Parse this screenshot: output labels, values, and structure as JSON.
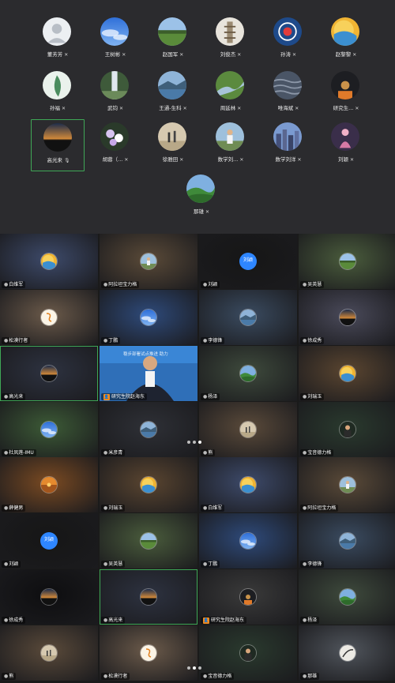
{
  "top_panel": {
    "participants": [
      {
        "name": "董芳芳",
        "avatar": "default-avatar"
      },
      {
        "name": "王树彬",
        "avatar": "blue-sky"
      },
      {
        "name": "赵国军",
        "avatar": "green-field"
      },
      {
        "name": "刘俊杰",
        "avatar": "pagoda"
      },
      {
        "name": "孙涛",
        "avatar": "blue-logo"
      },
      {
        "name": "赵黎黎",
        "avatar": "yellow-orb"
      },
      {
        "name": "孙福",
        "avatar": "green-plant"
      },
      {
        "name": "武钧",
        "avatar": "waterfall"
      },
      {
        "name": "王通-生科",
        "avatar": "lake"
      },
      {
        "name": "周延林",
        "avatar": "river-valley"
      },
      {
        "name": "唯海斌",
        "avatar": "water"
      },
      {
        "name": "研究生...",
        "avatar": "dark-portrait"
      },
      {
        "name": "高光来",
        "avatar": "sunset"
      },
      {
        "name": "胡蓉（...",
        "avatar": "flowers"
      },
      {
        "name": "徐雅田",
        "avatar": "beach-people"
      },
      {
        "name": "数学刘...",
        "avatar": "person-outdoor"
      },
      {
        "name": "数学刘洋",
        "avatar": "city"
      },
      {
        "name": "刘颖",
        "avatar": "pink-figure"
      },
      {
        "name": "那雄",
        "avatar": "green-hills"
      }
    ]
  },
  "grid1": {
    "tiles": [
      {
        "name": "白维军",
        "avatar": "yellow-orb",
        "bg": "#3d4a6a"
      },
      {
        "name": "阿拉坦宝力格",
        "avatar": "person-outdoor",
        "bg": "#5a4a38"
      },
      {
        "name": "刘颖",
        "avatar": "text",
        "avatar_text": "刘颖",
        "bg": "#161616"
      },
      {
        "name": "吴英慧",
        "avatar": "green-field",
        "bg": "#4a5c3c"
      },
      {
        "name": "松漠行者",
        "avatar": "logo-orange",
        "bg": "#6b5a4a"
      },
      {
        "name": "丁鹏",
        "avatar": "blue-sky",
        "bg": "#2e4a7a"
      },
      {
        "name": "李德锋",
        "avatar": "lake",
        "bg": "#3a4b60"
      },
      {
        "name": "徐成秀",
        "avatar": "sunset",
        "bg": "#4a4a5a"
      },
      {
        "name": "高光来",
        "avatar": "sunset",
        "bg": "#2d3240"
      },
      {
        "name": "研究生院赵海东",
        "avatar": "live-video",
        "bg": "#ffffff"
      },
      {
        "name": "杨泽",
        "avatar": "green-hills",
        "bg": "#3e4a3c"
      },
      {
        "name": "刘瑞玉",
        "avatar": "yellow-orb",
        "bg": "#5a4530"
      },
      {
        "name": "杜凤莲-IMU",
        "avatar": "blue-sky",
        "bg": "#3c5a36"
      },
      {
        "name": "米彦青",
        "avatar": "lake",
        "bg": "#2e3036"
      },
      {
        "name": "熊",
        "avatar": "beach-people",
        "bg": "#5a4a3a"
      },
      {
        "name": "宝音德力格",
        "avatar": "person-dark",
        "bg": "#2a3a2e"
      }
    ],
    "page_dots": 3,
    "active_dot": 2
  },
  "grid2": {
    "tiles": [
      {
        "name": "薛健男",
        "avatar": "sunset-orange",
        "bg": "#7a4a22"
      },
      {
        "name": "刘瑞玉",
        "avatar": "yellow-orb",
        "bg": "#5a4530"
      },
      {
        "name": "白维军",
        "avatar": "yellow-orb",
        "bg": "#3d4a6a"
      },
      {
        "name": "阿拉坦宝力格",
        "avatar": "person-outdoor",
        "bg": "#5a4a38"
      },
      {
        "name": "刘颖",
        "avatar": "text",
        "avatar_text": "刘颖",
        "bg": "#161616"
      },
      {
        "name": "吴英慧",
        "avatar": "green-field",
        "bg": "#4a5c3c"
      },
      {
        "name": "丁鹏",
        "avatar": "blue-sky",
        "bg": "#2e4a7a"
      },
      {
        "name": "李德锋",
        "avatar": "lake",
        "bg": "#3a4b60"
      },
      {
        "name": "徐成秀",
        "avatar": "sunset",
        "bg": "#0e0e10"
      },
      {
        "name": "高光来",
        "avatar": "sunset",
        "bg": "#2d3240"
      },
      {
        "name": "研究生院赵海东",
        "avatar": "dark-portrait",
        "bg": "#3a3a3a"
      },
      {
        "name": "杨泽",
        "avatar": "green-hills",
        "bg": "#3e4a3c"
      },
      {
        "name": "熊",
        "avatar": "beach-people",
        "bg": "#5a4a3a"
      },
      {
        "name": "松漠行者",
        "avatar": "logo-orange",
        "bg": "#6b5a4a"
      },
      {
        "name": "宝音德力格",
        "avatar": "person-dark",
        "bg": "#2a3a2e"
      },
      {
        "name": "那雄",
        "avatar": "brush",
        "bg": "#50555c"
      }
    ],
    "page_dots": 3,
    "active_dot": 1
  },
  "video_overlay_text": "稳步部署试点推进 助力"
}
